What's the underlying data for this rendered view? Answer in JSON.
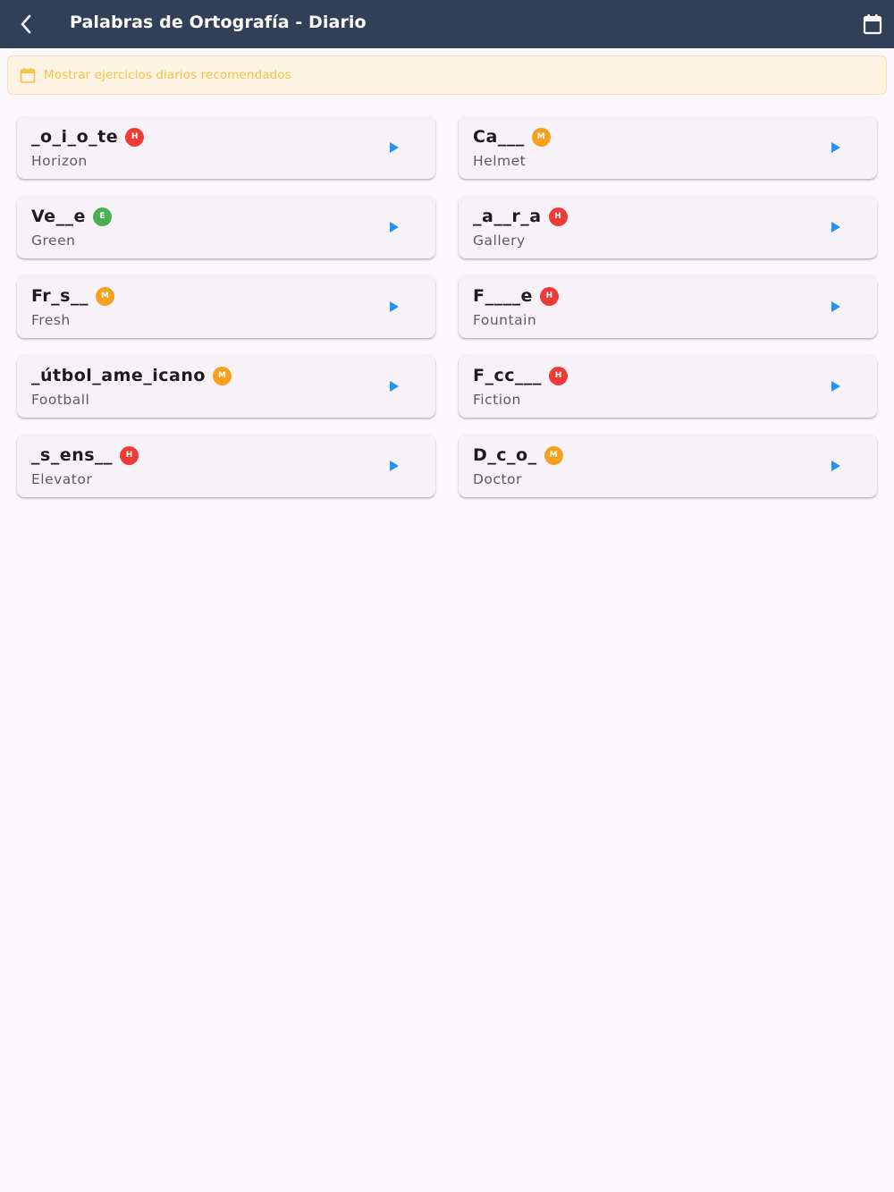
{
  "app_bar": {
    "title": "Palabras de Ortografía - Diario",
    "back_icon": "chevron-left-icon",
    "calendar_icon": "calendar-icon",
    "background": "#323f58"
  },
  "banner": {
    "text": "Mostrar ejercicios diarios recomendados",
    "icon": "calendar-icon",
    "text_color": "#f3c24a"
  },
  "difficulty_colors": {
    "H": "#ef3b36",
    "M": "#f7a01b",
    "E": "#4caf50"
  },
  "play_color": "#2394f3",
  "words": [
    {
      "masked": "_o_i_o_te",
      "answer": "Horizon",
      "level": "H"
    },
    {
      "masked": "Ca___",
      "answer": "Helmet",
      "level": "M"
    },
    {
      "masked": "Ve__e",
      "answer": "Green",
      "level": "E"
    },
    {
      "masked": "_a__r_a",
      "answer": "Gallery",
      "level": "H"
    },
    {
      "masked": "Fr_s__",
      "answer": "Fresh",
      "level": "M"
    },
    {
      "masked": "F____e",
      "answer": "Fountain",
      "level": "H"
    },
    {
      "masked": "_útbol_ame_icano",
      "answer": "Football",
      "level": "M"
    },
    {
      "masked": "F_cc___",
      "answer": "Fiction",
      "level": "H"
    },
    {
      "masked": "_s_ens__",
      "answer": "Elevator",
      "level": "H"
    },
    {
      "masked": "D_c_o_",
      "answer": "Doctor",
      "level": "M"
    }
  ]
}
